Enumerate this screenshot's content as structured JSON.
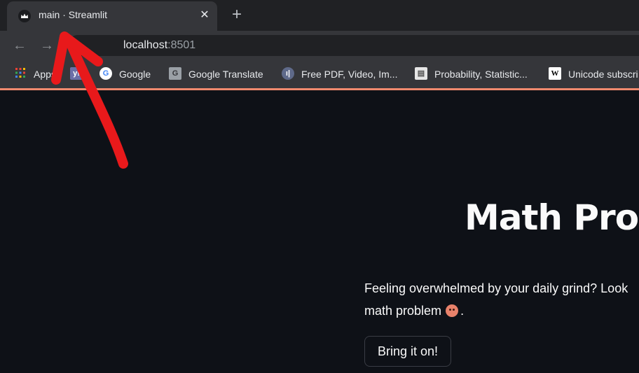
{
  "tab": {
    "title": "main · Streamlit",
    "close": "✕",
    "new_tab": "+"
  },
  "toolbar": {
    "back": "←",
    "forward": "→",
    "url_host": "localhost",
    "url_port": ":8501"
  },
  "bookmarks": [
    {
      "label": "Apps",
      "icon": "apps-grid-icon"
    },
    {
      "label": "",
      "icon": "yahoo-icon"
    },
    {
      "label": "Google",
      "icon": "google-icon"
    },
    {
      "label": "Google Translate",
      "icon": "google-translate-icon"
    },
    {
      "label": "Free PDF, Video, Im...",
      "icon": "pdf-tool-icon"
    },
    {
      "label": "Probability, Statistic...",
      "icon": "document-icon"
    },
    {
      "label": "Unicode subscri",
      "icon": "wikipedia-icon"
    }
  ],
  "colors": {
    "page_bg": "#0e1117",
    "chrome_tab": "#35363a",
    "accent_line": "#f08a6e",
    "annotation": "#e8191b"
  },
  "page": {
    "title": "Math Prob",
    "intro_line1": "Feeling overwhelmed by your daily grind? Look",
    "intro_line2": "math problem",
    "intro_end": ".",
    "button": "Bring it on!"
  }
}
